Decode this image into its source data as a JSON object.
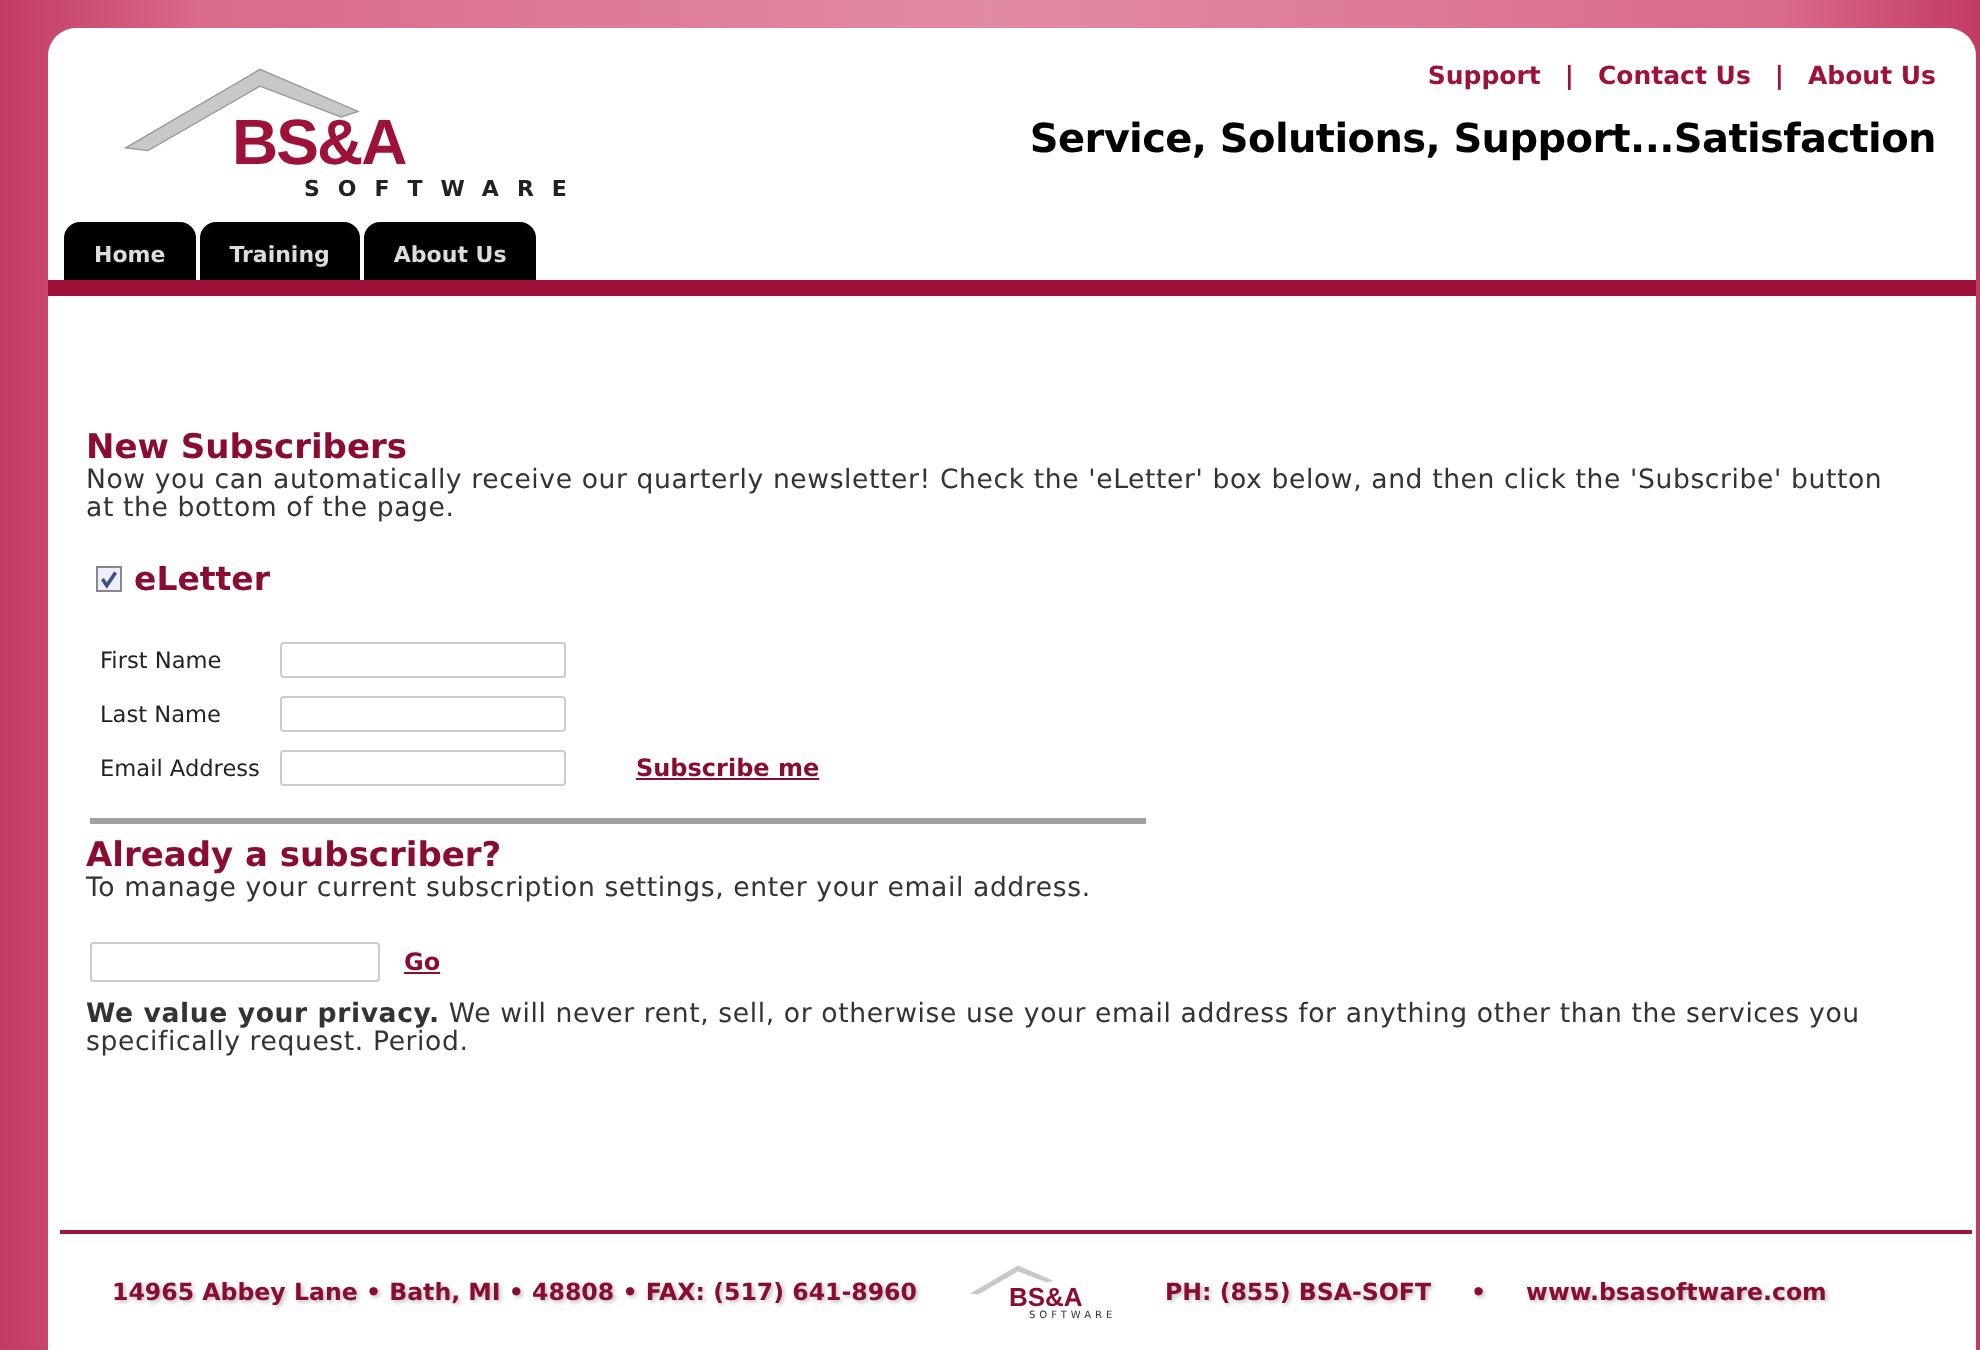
{
  "header": {
    "logo": {
      "name": "BS&A",
      "sub": "SOFTWARE"
    },
    "links": [
      "Support",
      "Contact Us",
      "About Us"
    ],
    "separator": "|",
    "slogan": "Service, Solutions, Support...Satisfaction",
    "tabs": [
      "Home",
      "Training",
      "About Us"
    ]
  },
  "new_subscribers": {
    "title": "New Subscribers",
    "text": "Now you can automatically receive our quarterly newsletter! Check the 'eLetter' box below, and then click the 'Subscribe' button at the bottom of the page.",
    "eletter": {
      "label": "eLetter",
      "checked": true
    },
    "fields": [
      {
        "label": "First Name"
      },
      {
        "label": "Last Name"
      },
      {
        "label": "Email Address"
      }
    ],
    "subscribe_link": "Subscribe me"
  },
  "existing": {
    "title": "Already a subscriber?",
    "text": "To manage your current subscription settings, enter your email address.",
    "go_link": "Go"
  },
  "privacy": "**We value your privacy.** We will never rent, sell, or otherwise use your email address for anything other than the services you specifically request. Period.",
  "footer": {
    "address": "14965 Abbey Lane • Bath, MI • 48808 • FAX: (517) 641-8960",
    "logo": {
      "name": "BS&A",
      "sub": "SOFTWARE"
    },
    "phone": "PH: (855) BSA-SOFT",
    "bullet": "•",
    "website": "www.bsasoftware.com"
  }
}
